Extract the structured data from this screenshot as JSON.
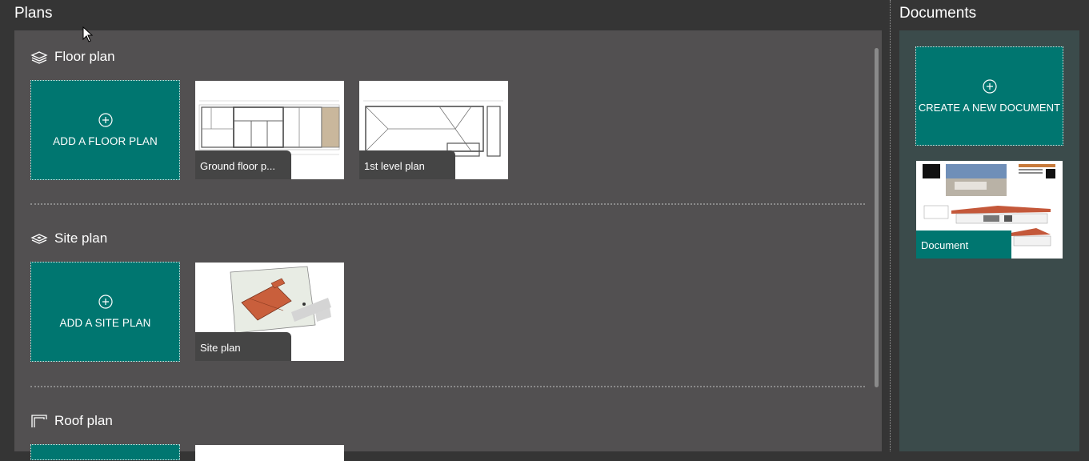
{
  "plans": {
    "title": "Plans",
    "sections": [
      {
        "title": "Floor plan",
        "icon": "layers-icon",
        "add_label": "ADD A FLOOR PLAN",
        "items": [
          {
            "label": "Ground floor p..."
          },
          {
            "label": "1st level plan"
          }
        ]
      },
      {
        "title": "Site plan",
        "icon": "site-layer-icon",
        "add_label": "ADD A SITE PLAN",
        "items": [
          {
            "label": "Site plan"
          }
        ]
      },
      {
        "title": "Roof plan",
        "icon": "roof-icon",
        "add_label": "",
        "items": []
      }
    ]
  },
  "documents": {
    "title": "Documents",
    "create_label": "CREATE A NEW DOCUMENT",
    "items": [
      {
        "label": "Document"
      }
    ]
  },
  "colors": {
    "accent": "#007670",
    "plans_panel": "#525051",
    "docs_panel": "#3b4b4b",
    "background": "#353535"
  }
}
